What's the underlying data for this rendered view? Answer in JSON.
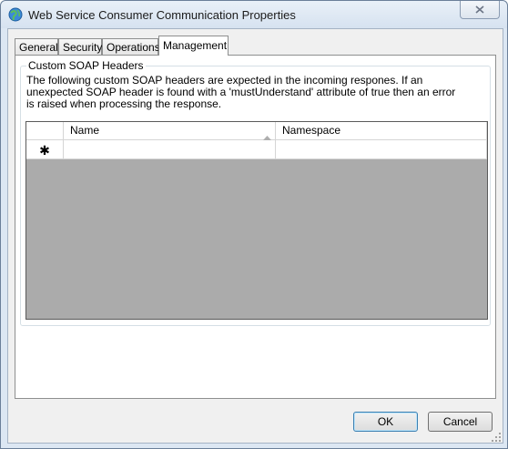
{
  "window": {
    "title": "Web Service Consumer Communication Properties"
  },
  "tabs": [
    {
      "label": "General"
    },
    {
      "label": "Security"
    },
    {
      "label": "Operations"
    },
    {
      "label": "Management"
    }
  ],
  "group": {
    "title": "Custom SOAP Headers",
    "description": "The following custom SOAP headers are expected in the incoming respones. If an unexpected SOAP header is found with a 'mustUnderstand' attribute of true then an error is raised when processing the response."
  },
  "grid": {
    "columns": [
      {
        "label": "Name"
      },
      {
        "label": "Namespace"
      }
    ],
    "new_row_marker": "✱"
  },
  "buttons": {
    "ok": "OK",
    "cancel": "Cancel"
  },
  "icons": {
    "app": "globe-window-icon",
    "close": "close-icon",
    "sort": "sort-ascending-icon",
    "grip": "resize-grip-icon"
  }
}
